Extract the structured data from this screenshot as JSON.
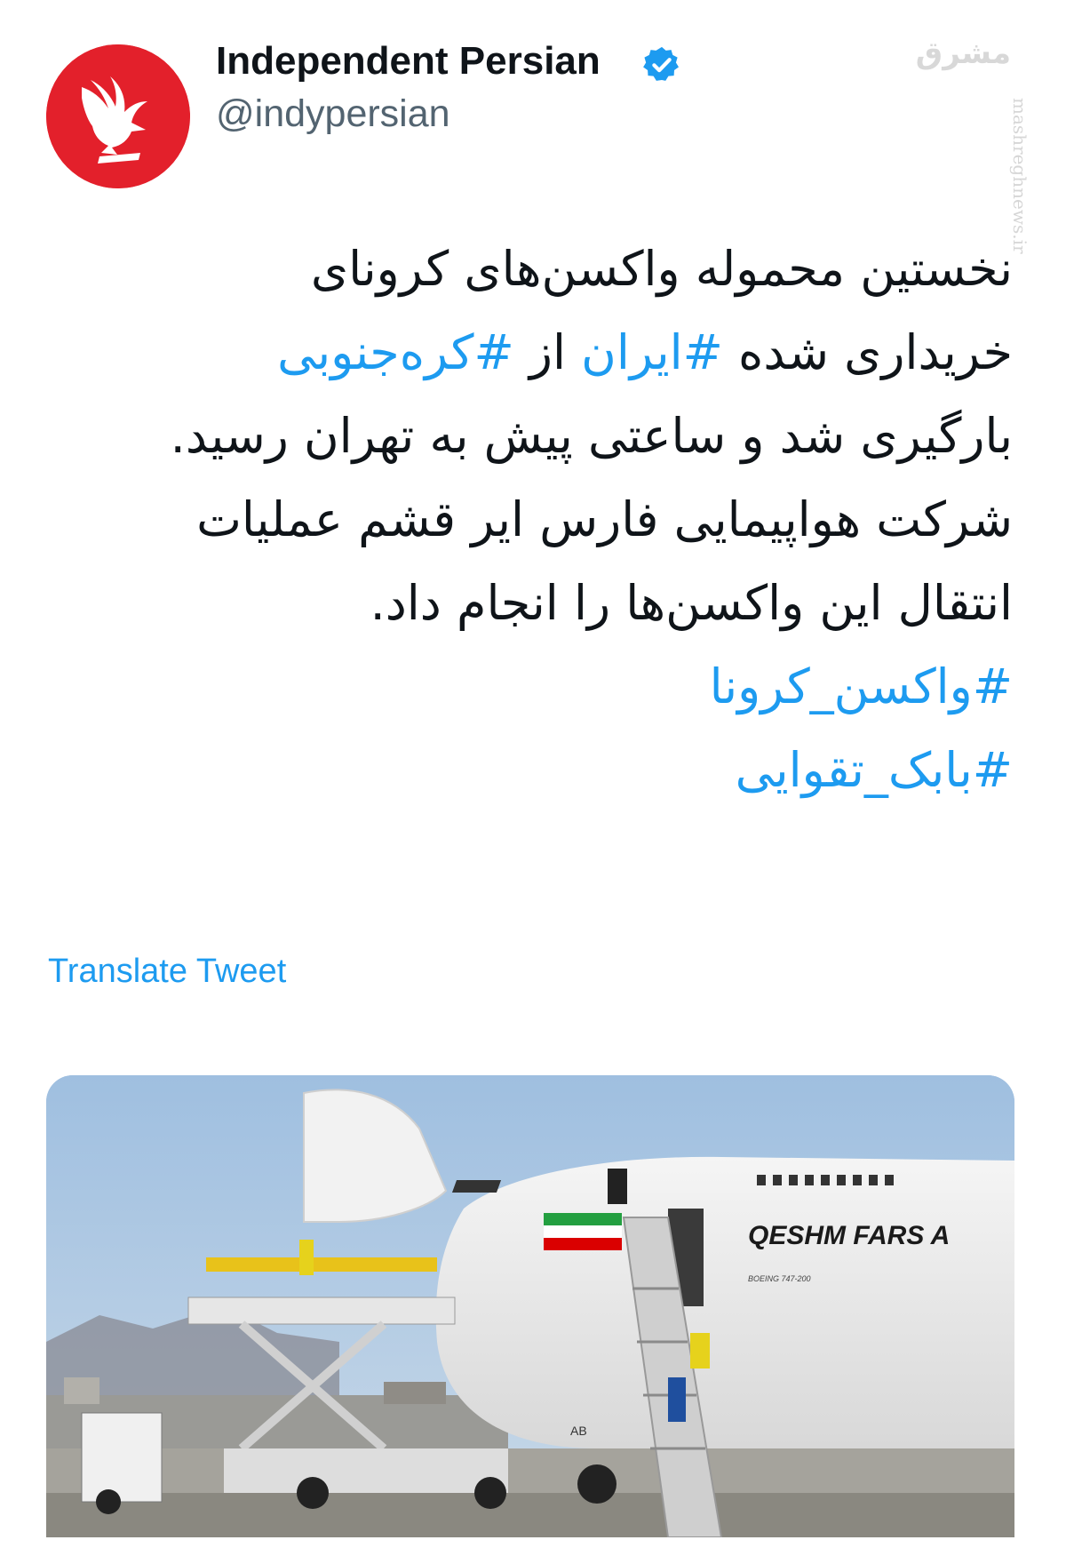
{
  "tweet": {
    "display_name": "Independent Persian",
    "handle": "@indypersian",
    "verified": true,
    "text_lines": [
      [
        {
          "t": "نخستین محموله واکسن‌های کرونای",
          "h": false
        }
      ],
      [
        {
          "t": "خریداری شده ",
          "h": false
        },
        {
          "t": "#ایران",
          "h": true
        },
        {
          "t": " از ",
          "h": false
        },
        {
          "t": "#کره‌جنوبی",
          "h": true
        }
      ],
      [
        {
          "t": "بارگیری شد و ساعتی پیش به تهران رسید.",
          "h": false
        }
      ],
      [
        {
          "t": "شرکت هواپیمایی فارس ایر قشم عملیات",
          "h": false
        }
      ],
      [
        {
          "t": "انتقال این واکسن‌ها را انجام داد.",
          "h": false
        }
      ]
    ],
    "hashtags": [
      "#واکسن_کرونا",
      "#بابک_تقوایی"
    ],
    "translate_label": "Translate Tweet"
  },
  "media": {
    "aircraft_livery": "QESHM FARS A",
    "aircraft_model": "BOEING 747-200",
    "registration": "AB"
  },
  "watermark": {
    "logo_text": "مشرق",
    "url": "mashreghnews.ir"
  },
  "colors": {
    "link": "#1d9bf0",
    "avatar_red": "#e3202b",
    "text": "#0f1419",
    "secondary": "#536471"
  }
}
